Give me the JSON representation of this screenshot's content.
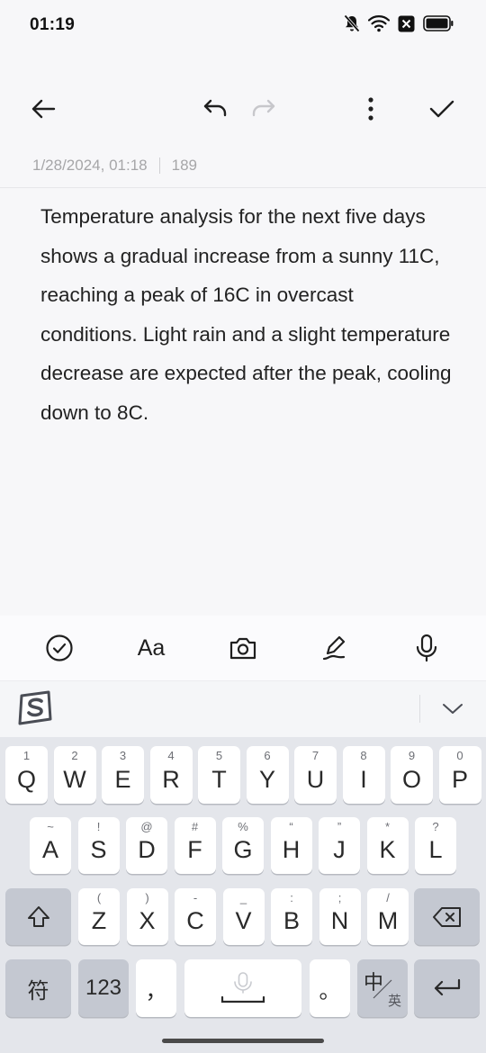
{
  "status_bar": {
    "time": "01:19"
  },
  "meta": {
    "datetime": "1/28/2024, 01:18",
    "char_count": "189"
  },
  "note": {
    "text": "Temperature analysis for the next five days shows a gradual increase from a sunny 11C, reaching a peak of 16C in overcast conditions. Light rain and a slight temperature decrease are expected after the peak, cooling down to 8C."
  },
  "format_bar": {
    "text_style_label": "Aa"
  },
  "keyboard": {
    "row1": [
      {
        "key": "Q",
        "sub": "1"
      },
      {
        "key": "W",
        "sub": "2"
      },
      {
        "key": "E",
        "sub": "3"
      },
      {
        "key": "R",
        "sub": "4"
      },
      {
        "key": "T",
        "sub": "5"
      },
      {
        "key": "Y",
        "sub": "6"
      },
      {
        "key": "U",
        "sub": "7"
      },
      {
        "key": "I",
        "sub": "8"
      },
      {
        "key": "O",
        "sub": "9"
      },
      {
        "key": "P",
        "sub": "0"
      }
    ],
    "row2": [
      {
        "key": "A",
        "sub": "~"
      },
      {
        "key": "S",
        "sub": "!"
      },
      {
        "key": "D",
        "sub": "@"
      },
      {
        "key": "F",
        "sub": "#"
      },
      {
        "key": "G",
        "sub": "%"
      },
      {
        "key": "H",
        "sub": "“"
      },
      {
        "key": "J",
        "sub": "”"
      },
      {
        "key": "K",
        "sub": "*"
      },
      {
        "key": "L",
        "sub": "?"
      }
    ],
    "row3": [
      {
        "key": "Z",
        "sub": "("
      },
      {
        "key": "X",
        "sub": ")"
      },
      {
        "key": "C",
        "sub": "-"
      },
      {
        "key": "V",
        "sub": "_"
      },
      {
        "key": "B",
        "sub": ":"
      },
      {
        "key": "N",
        "sub": ";"
      },
      {
        "key": "M",
        "sub": "/"
      }
    ],
    "symbols_label": "符",
    "numbers_label": "123",
    "comma_label": "，",
    "period_label": "。",
    "lang_main": "中",
    "lang_sub": "英"
  },
  "colors": {
    "background": "#f7f7f9",
    "keyboard_bg": "#e4e6eb",
    "key_dark": "#c4c8d1"
  }
}
